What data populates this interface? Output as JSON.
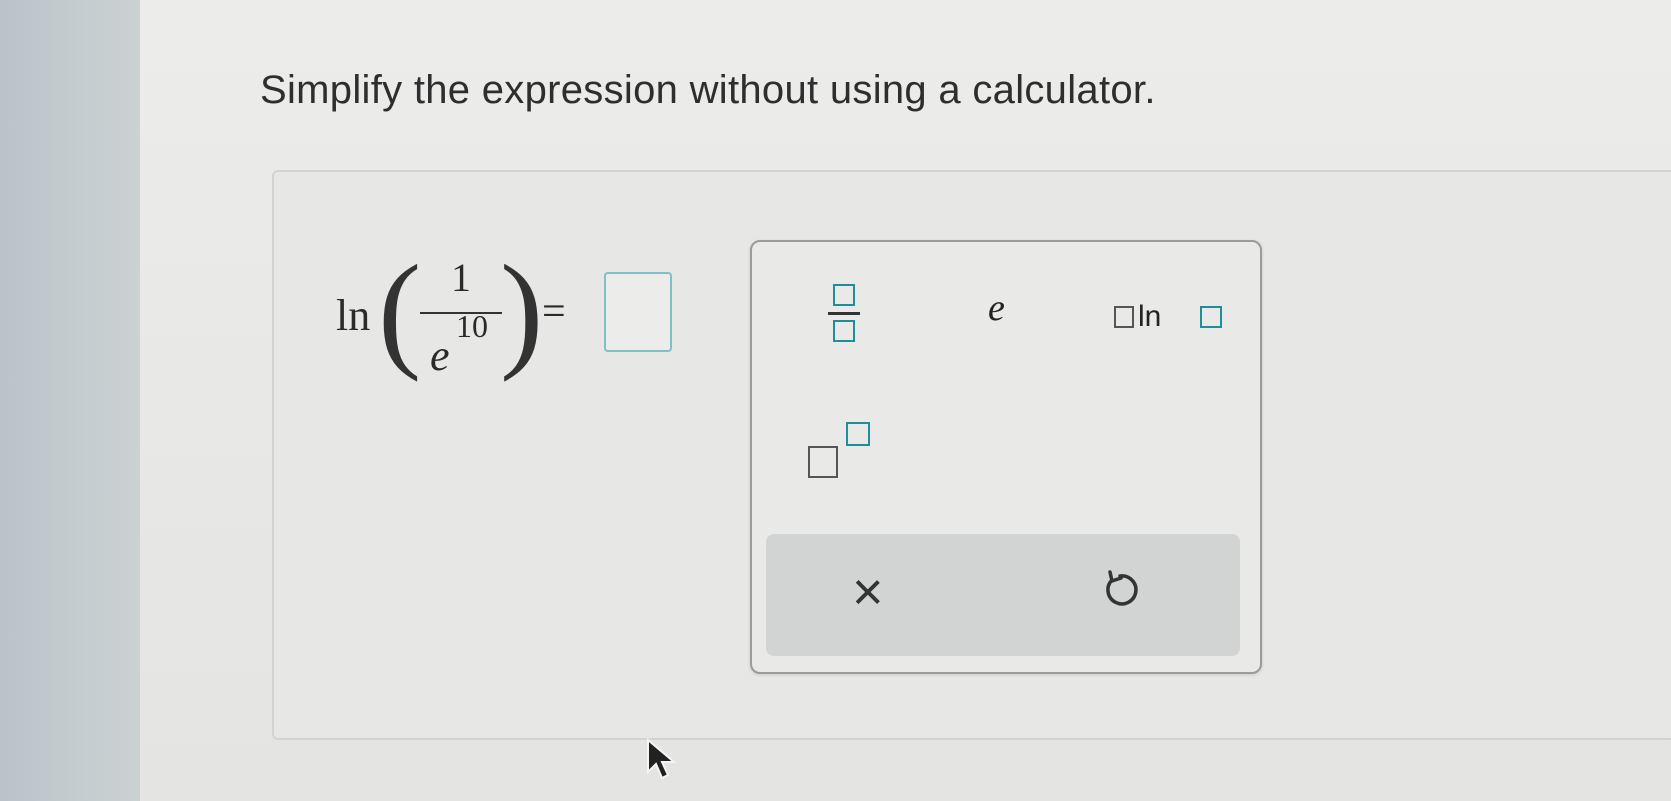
{
  "prompt": "Simplify the expression without using a calculator.",
  "expression": {
    "function": "ln",
    "numerator": "1",
    "denominator_base": "e",
    "denominator_exponent": "10",
    "equals": "="
  },
  "answer": {
    "value": ""
  },
  "palette": {
    "fraction_label": "fraction",
    "e_label": "e",
    "log_text": "ln",
    "exponent_label": "exponent",
    "clear_symbol": "×",
    "undo_symbol": "undo"
  },
  "colors": {
    "accent": "#1f8e9b",
    "input_border": "#7fc0c4",
    "action_bar": "#d2d3d3"
  }
}
